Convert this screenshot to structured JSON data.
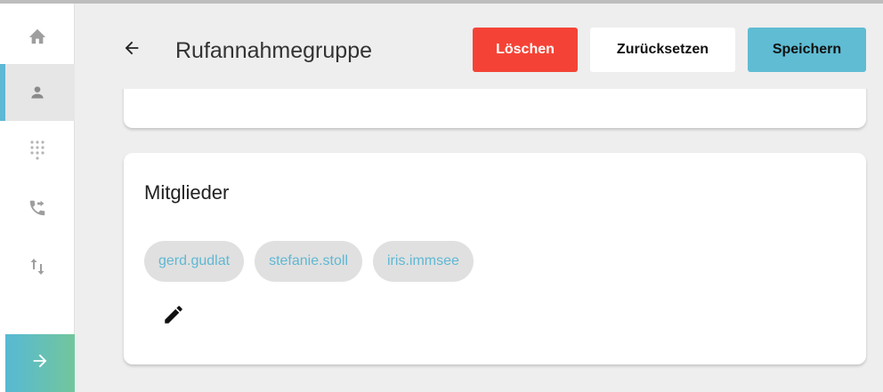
{
  "header": {
    "title": "Rufannahmegruppe",
    "delete_label": "Löschen",
    "reset_label": "Zurücksetzen",
    "save_label": "Speichern"
  },
  "sidebar": {
    "items": [
      {
        "icon": "home-icon",
        "active": false
      },
      {
        "icon": "person-icon",
        "active": true
      },
      {
        "icon": "dialpad-icon",
        "active": false
      },
      {
        "icon": "phone-forward-icon",
        "active": false
      },
      {
        "icon": "swap-vert-icon",
        "active": false
      }
    ],
    "expand_icon": "arrow-right-icon"
  },
  "members_card": {
    "title": "Mitglieder",
    "members": [
      "gerd.gudlat",
      "stefanie.stoll",
      "iris.immsee"
    ],
    "edit_icon": "pencil-icon"
  },
  "colors": {
    "accent": "#5fb8d4",
    "delete": "#f44336",
    "save": "#5fbcd3",
    "gradient_start": "#57b9d4",
    "gradient_end": "#72c69c"
  }
}
